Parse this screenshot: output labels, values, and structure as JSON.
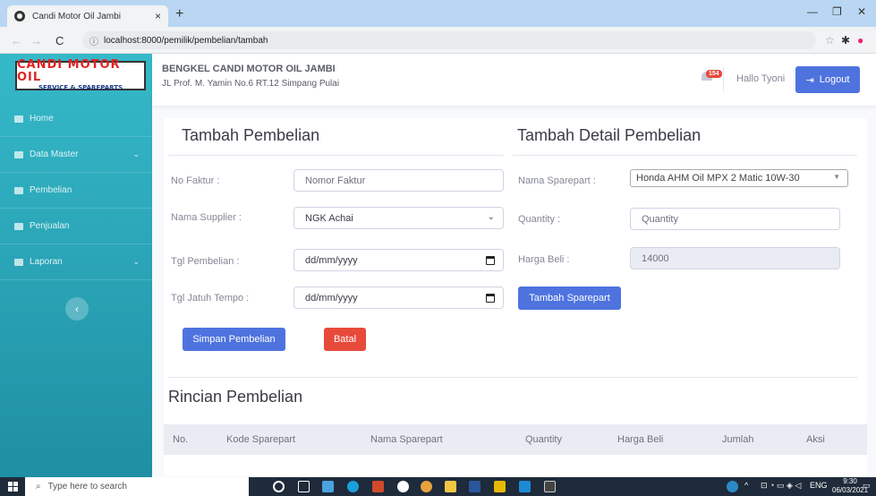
{
  "browser": {
    "tab_title": "Candi Motor Oil Jambi",
    "tab_close": "×",
    "new_tab": "+",
    "url": "localhost:8000/pemilik/pembelian/tambah"
  },
  "brand": {
    "line1": "CANDI MOTOR OIL",
    "line2": "SERVICE & SPAREPARTS"
  },
  "sidebar": {
    "items": [
      {
        "label": "Home",
        "icon": "home-icon"
      },
      {
        "label": "Data Master",
        "icon": "database-icon",
        "has_children": true
      },
      {
        "label": "Pembelian",
        "icon": "cart-icon"
      },
      {
        "label": "Penjualan",
        "icon": "cashier-icon"
      },
      {
        "label": "Laporan",
        "icon": "report-icon",
        "has_children": true
      }
    ]
  },
  "topbar": {
    "shop_name": "BENGKEL CANDI MOTOR OIL JAMBI",
    "address": "JL Prof. M. Yamin No.6 RT.12 Simpang Pulai",
    "notification_count": "154",
    "greeting": "Hallo Tyoni",
    "logout_label": "Logout"
  },
  "form": {
    "title": "Tambah Pembelian",
    "no_faktur_label": "No Faktur :",
    "no_faktur_placeholder": "Nomor Faktur",
    "supplier_label": "Nama Supplier :",
    "supplier_value": "NGK Achai",
    "tgl_pembelian_label": "Tgl Pembelian :",
    "tgl_pembelian_value": "dd/mm/yyyy",
    "tgl_jatuh_tempo_label": "Tgl Jatuh Tempo :",
    "tgl_jatuh_tempo_value": "dd/mm/yyyy",
    "save_label": "Simpan Pembelian",
    "cancel_label": "Batal"
  },
  "detail": {
    "title": "Tambah Detail Pembelian",
    "sparepart_label": "Nama Sparepart :",
    "sparepart_value": "Honda AHM Oil MPX 2 Matic 10W-30",
    "quantity_label": "Quantity :",
    "quantity_placeholder": "Quantity",
    "harga_label": "Harga Beli :",
    "harga_value": "14000",
    "add_label": "Tambah Sparepart"
  },
  "rincian": {
    "title": "Rincian Pembelian",
    "columns": [
      "No.",
      "Kode Sparepart",
      "Nama Sparepart",
      "Quantity",
      "Harga Beli",
      "Jumlah",
      "Aksi"
    ]
  },
  "taskbar": {
    "search_placeholder": "Type here to search",
    "language": "ENG",
    "time": "9:30",
    "date": "06/03/2021"
  }
}
